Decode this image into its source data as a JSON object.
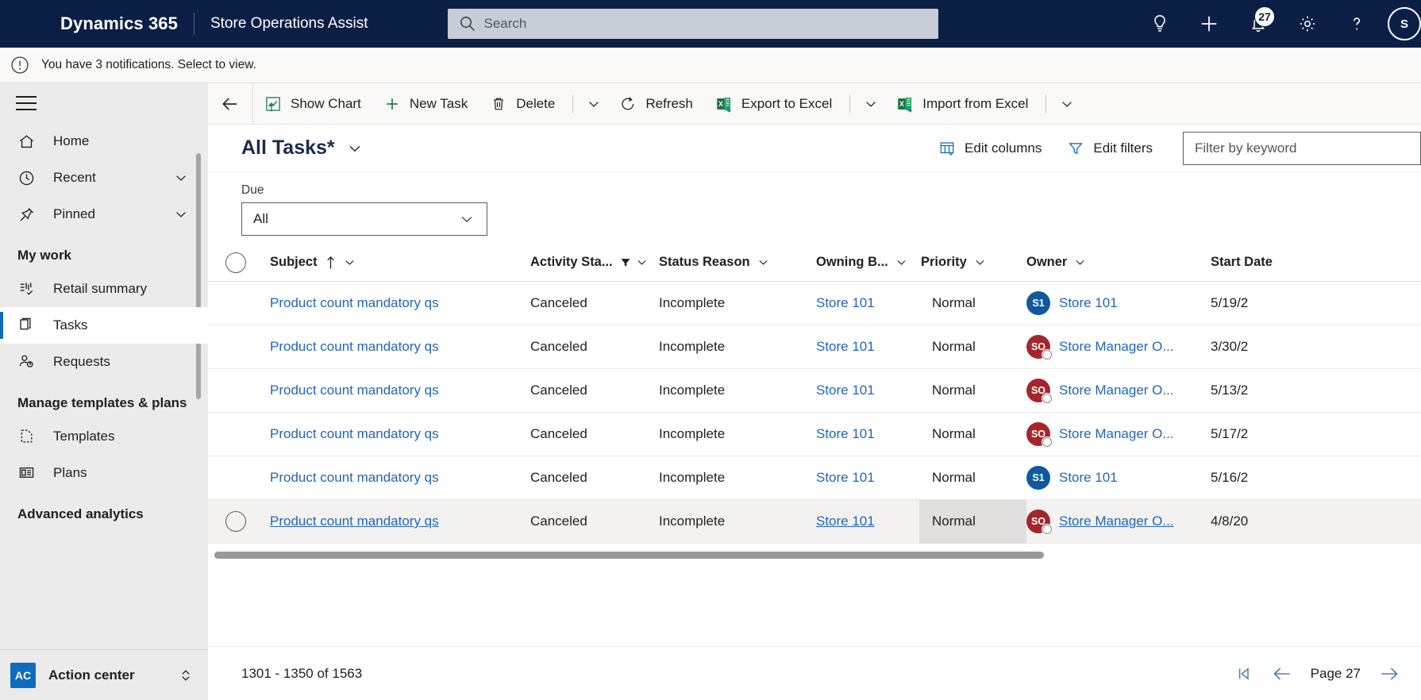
{
  "topnav": {
    "brand": "Dynamics 365",
    "app_name": "Store Operations Assist",
    "search_placeholder": "Search",
    "search_value": "",
    "icons": [
      {
        "name": "lightbulb-icon",
        "label": "Ideas"
      },
      {
        "name": "plus-icon",
        "label": "Quick create"
      },
      {
        "name": "bell-icon",
        "label": "Notifications",
        "badge": "27"
      },
      {
        "name": "gear-icon",
        "label": "Settings"
      },
      {
        "name": "question-icon",
        "label": "Help"
      }
    ],
    "avatar_initials": "S"
  },
  "notification": {
    "icon": "exclamation-circle-icon",
    "text": "You have 3 notifications. Select to view."
  },
  "sidebar": {
    "hamburger_label": "Site map",
    "items": [
      {
        "label": "Home",
        "icon": "home-icon",
        "expandable": false,
        "active": false
      },
      {
        "label": "Recent",
        "icon": "clock-icon",
        "expandable": true,
        "active": false
      },
      {
        "label": "Pinned",
        "icon": "pin-icon",
        "expandable": true,
        "active": false
      }
    ],
    "groups": [
      {
        "title": "My work",
        "items": [
          {
            "label": "Retail summary",
            "icon": "retail-summary-icon",
            "active": false
          },
          {
            "label": "Tasks",
            "icon": "tasks-icon",
            "active": true
          },
          {
            "label": "Requests",
            "icon": "requests-icon",
            "active": false
          }
        ]
      },
      {
        "title": "Manage templates & plans",
        "items": [
          {
            "label": "Templates",
            "icon": "template-icon",
            "active": false
          },
          {
            "label": "Plans",
            "icon": "plans-icon",
            "active": false
          }
        ]
      },
      {
        "title": "Advanced analytics",
        "items": []
      }
    ],
    "footer": {
      "badge": "AC",
      "label": "Action center",
      "icon": "chevron-updown-icon"
    }
  },
  "commandbar": {
    "back_icon": "back-arrow-icon",
    "buttons": [
      {
        "label": "Show Chart",
        "icon": "show-chart-icon"
      },
      {
        "label": "New Task",
        "icon": "plus-icon"
      },
      {
        "label": "Delete",
        "icon": "trash-icon"
      },
      {
        "label": "Refresh",
        "icon": "refresh-icon"
      },
      {
        "label": "Export to Excel",
        "icon": "excel-export-icon"
      },
      {
        "label": "Import from Excel",
        "icon": "excel-import-icon"
      }
    ]
  },
  "viewbar": {
    "title": "All Tasks*",
    "title_chevron": "chevron-down-icon",
    "edit_columns": "Edit columns",
    "edit_columns_icon": "edit-columns-icon",
    "edit_filters": "Edit filters",
    "edit_filters_icon": "filter-icon",
    "keyword_placeholder": "Filter by keyword",
    "keyword_value": ""
  },
  "duefilter": {
    "label": "Due",
    "value": "All",
    "chevron": "chevron-down-icon"
  },
  "grid": {
    "columns": [
      {
        "key": "select",
        "label": "",
        "icon": "select-all-circle"
      },
      {
        "key": "subject",
        "label": "Subject",
        "sort": "ascending",
        "sort_icon": "arrow-up-icon",
        "chevron": "chevron-down-icon"
      },
      {
        "key": "activity_status",
        "label": "Activity Sta...",
        "filtered": true,
        "filter_icon": "filter-filled-icon",
        "chevron": "chevron-down-icon"
      },
      {
        "key": "status_reason",
        "label": "Status Reason",
        "chevron": "chevron-down-icon"
      },
      {
        "key": "owning_business",
        "label": "Owning B...",
        "chevron": "chevron-down-icon"
      },
      {
        "key": "priority",
        "label": "Priority",
        "chevron": "chevron-down-icon"
      },
      {
        "key": "owner",
        "label": "Owner",
        "chevron": "chevron-down-icon"
      },
      {
        "key": "start_date",
        "label": "Start Date"
      }
    ],
    "rows": [
      {
        "subject": "Product count mandatory qs",
        "activity_status": "Canceled",
        "status_reason": "Incomplete",
        "owning_business": "Store 101",
        "priority": "Normal",
        "owner": "Store 101",
        "owner_initials": "S1",
        "owner_color": "#0f5a9e",
        "owner_presence": false,
        "start_date": "5/19/2"
      },
      {
        "subject": "Product count mandatory qs",
        "activity_status": "Canceled",
        "status_reason": "Incomplete",
        "owning_business": "Store 101",
        "priority": "Normal",
        "owner": "Store Manager O...",
        "owner_initials": "SO",
        "owner_color": "#a4262c",
        "owner_presence": true,
        "start_date": "3/30/2"
      },
      {
        "subject": "Product count mandatory qs",
        "activity_status": "Canceled",
        "status_reason": "Incomplete",
        "owning_business": "Store 101",
        "priority": "Normal",
        "owner": "Store Manager O...",
        "owner_initials": "SO",
        "owner_color": "#a4262c",
        "owner_presence": true,
        "start_date": "5/13/2"
      },
      {
        "subject": "Product count mandatory qs",
        "activity_status": "Canceled",
        "status_reason": "Incomplete",
        "owning_business": "Store 101",
        "priority": "Normal",
        "owner": "Store Manager O...",
        "owner_initials": "SO",
        "owner_color": "#a4262c",
        "owner_presence": true,
        "start_date": "5/17/2"
      },
      {
        "subject": "Product count mandatory qs",
        "activity_status": "Canceled",
        "status_reason": "Incomplete",
        "owning_business": "Store 101",
        "priority": "Normal",
        "owner": "Store 101",
        "owner_initials": "S1",
        "owner_color": "#0f5a9e",
        "owner_presence": false,
        "start_date": "5/16/2"
      },
      {
        "subject": "Product count mandatory qs",
        "activity_status": "Canceled",
        "status_reason": "Incomplete",
        "owning_business": "Store 101",
        "priority": "Normal",
        "owner": "Store Manager O...",
        "owner_initials": "SO",
        "owner_color": "#a4262c",
        "owner_presence": true,
        "start_date": "4/8/20",
        "hovered": true
      }
    ]
  },
  "pager": {
    "count_text": "1301 - 1350 of 1563",
    "first_icon": "page-first-icon",
    "prev_icon": "arrow-left-icon",
    "page_label": "Page 27",
    "next_icon": "arrow-right-icon"
  },
  "colors": {
    "nav_bg": "#0b1f45",
    "accent": "#0f6cbd",
    "link": "#2266bb",
    "avatar_blue": "#0f5a9e",
    "avatar_red": "#a4262c"
  }
}
